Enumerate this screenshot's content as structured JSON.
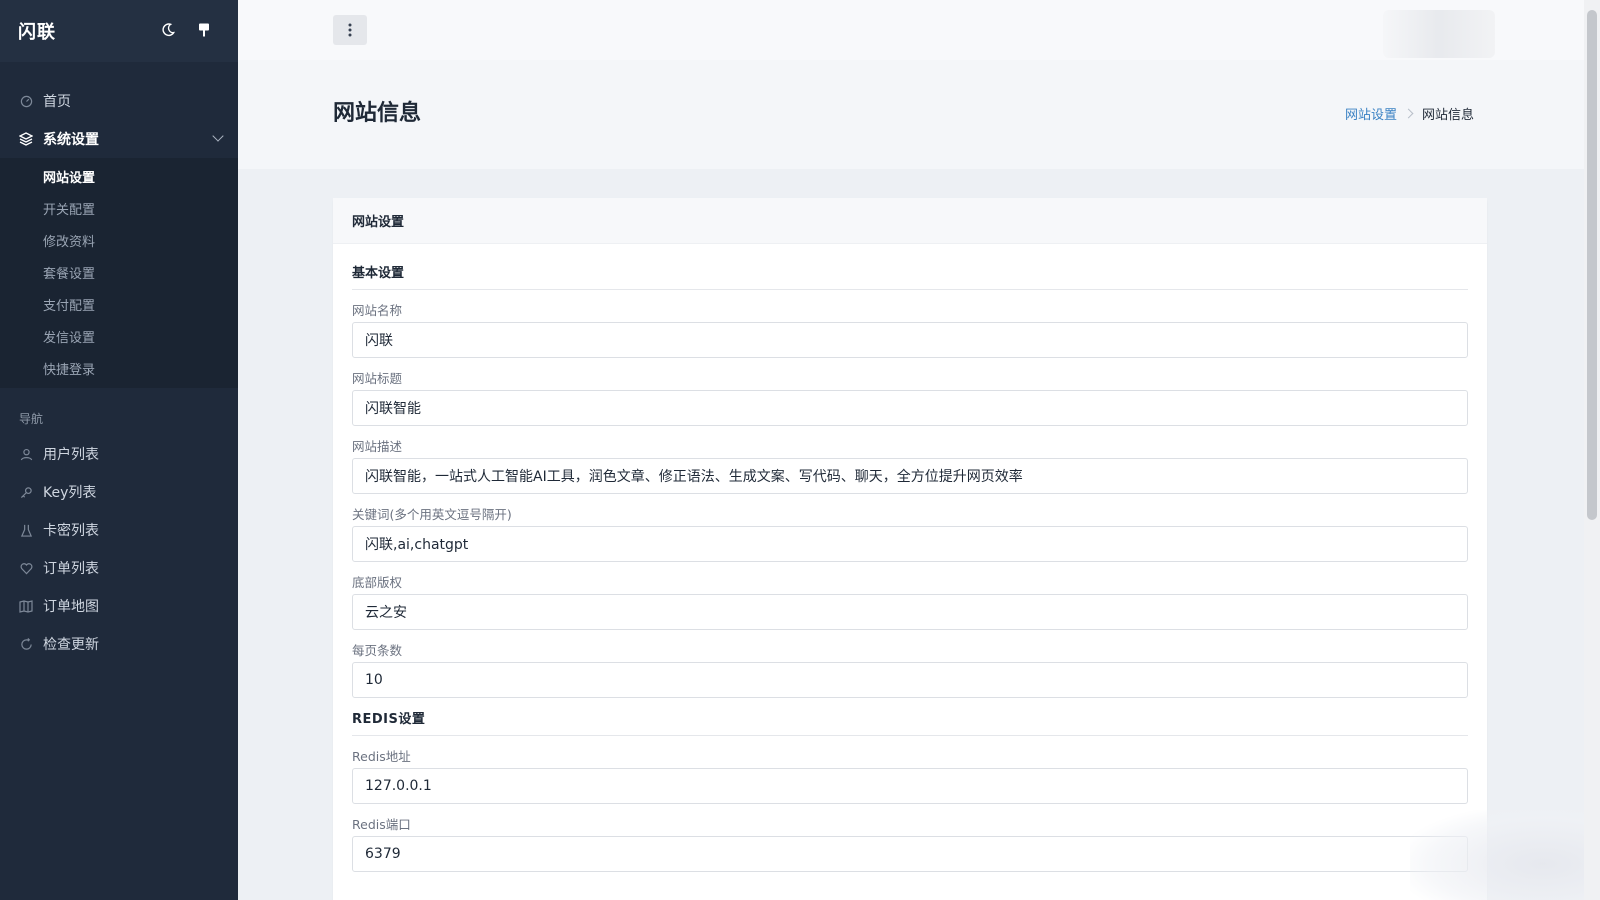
{
  "app": {
    "brand": "闪联"
  },
  "sidebar": {
    "main_items": [
      {
        "label": "首页",
        "icon": "dashboard-icon"
      },
      {
        "label": "系统设置",
        "icon": "layers-icon"
      }
    ],
    "submenu": [
      {
        "label": "网站设置"
      },
      {
        "label": "开关配置"
      },
      {
        "label": "修改资料"
      },
      {
        "label": "套餐设置"
      },
      {
        "label": "支付配置"
      },
      {
        "label": "发信设置"
      },
      {
        "label": "快捷登录"
      }
    ],
    "section_label": "导航",
    "nav_items": [
      {
        "label": "用户列表",
        "icon": "user-icon"
      },
      {
        "label": "Key列表",
        "icon": "key-icon"
      },
      {
        "label": "卡密列表",
        "icon": "flask-icon"
      },
      {
        "label": "订单列表",
        "icon": "heart-icon"
      },
      {
        "label": "订单地图",
        "icon": "map-icon"
      },
      {
        "label": "检查更新",
        "icon": "refresh-icon"
      }
    ]
  },
  "page": {
    "title": "网站信息",
    "breadcrumb": {
      "parent": "网站设置",
      "current": "网站信息"
    }
  },
  "card": {
    "title": "网站设置",
    "basic_group": "基本设置",
    "redis_group": "REDIS设置",
    "fields": {
      "site_name": {
        "label": "网站名称",
        "value": "闪联"
      },
      "site_title": {
        "label": "网站标题",
        "value": "闪联智能"
      },
      "site_desc": {
        "label": "网站描述",
        "value": "闪联智能，一站式人工智能AI工具，润色文章、修正语法、生成文案、写代码、聊天，全方位提升网页效率"
      },
      "keywords": {
        "label": "关键词(多个用英文逗号隔开)",
        "value": "闪联,ai,chatgpt"
      },
      "copyright": {
        "label": "底部版权",
        "value": "云之安"
      },
      "page_size": {
        "label": "每页条数",
        "value": "10"
      },
      "redis_host": {
        "label": "Redis地址",
        "value": "127.0.0.1"
      },
      "redis_port": {
        "label": "Redis端口",
        "value": "6379"
      }
    }
  }
}
